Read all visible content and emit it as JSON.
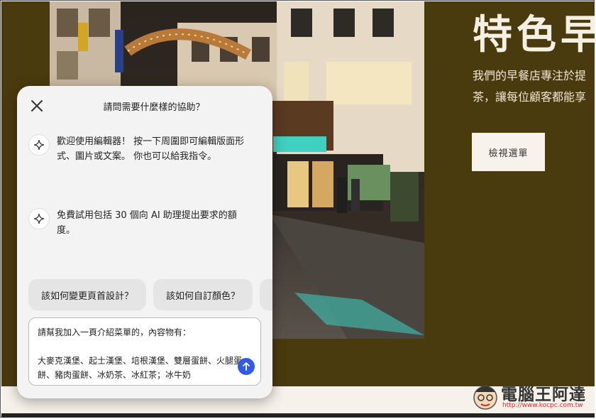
{
  "hero": {
    "title": "特色早",
    "description_lines": [
      "我們的早餐店專注於提",
      "茶，讓每位顧客都能享"
    ],
    "view_menu_label": "檢視選單"
  },
  "assistant": {
    "title": "請問需要什麼樣的協助？",
    "messages": [
      {
        "icon": "sparkle-icon",
        "text": "歡迎使用編輯器！ 按一下周圍即可編輯版面形式、圖片或文案。 你也可以給我指令。"
      },
      {
        "icon": "sparkle-icon",
        "text": "免費試用包括 30 個向 AI 助理提出要求的額度。"
      }
    ],
    "suggestions": [
      "該如何變更頁首設計？",
      "該如何自訂顏色？"
    ],
    "input_value": "請幫我加入一頁介紹菜單的，內容物有：\n\n大麥克漢堡、起士漢堡、培根漢堡、雙層蛋餅、火腿蛋餅、豬肉蛋餅、冰奶茶、冰紅茶；冰牛奶"
  },
  "watermark": {
    "site_name": "電腦王阿達",
    "url": "http://www.kocpc.com.tw"
  },
  "colors": {
    "page_background": "#4a3b0e",
    "panel_background": "#f4f3f3",
    "send_button": "#2f5be8"
  }
}
